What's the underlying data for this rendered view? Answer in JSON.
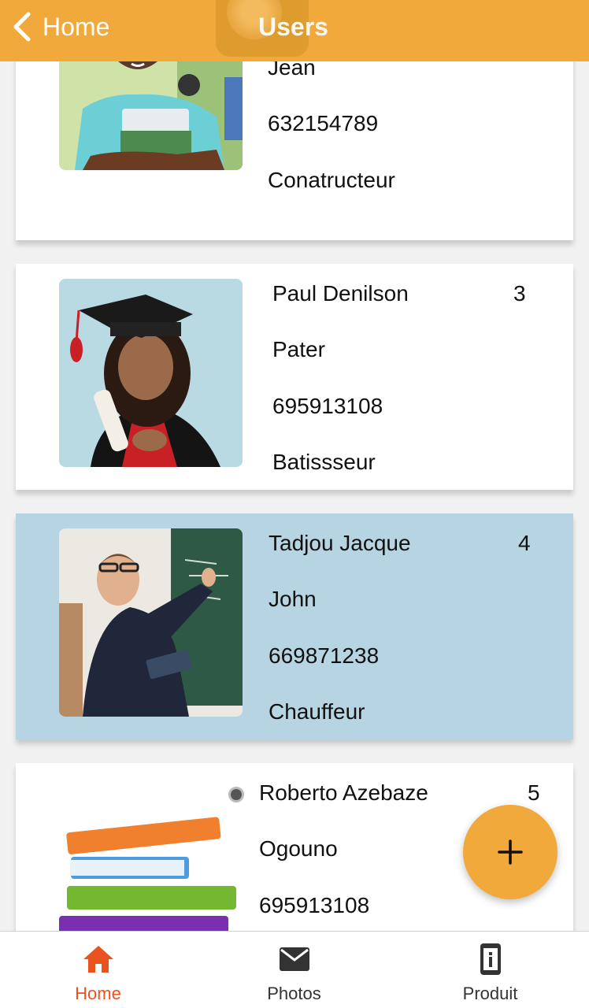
{
  "header": {
    "back_label": "Home",
    "title": "Users"
  },
  "users": [
    {
      "lines": [
        "Jean",
        "632154789",
        "Conatructeur"
      ],
      "index": ""
    },
    {
      "lines": [
        "Paul Denilson",
        "Pater",
        "695913108",
        "Batissseur"
      ],
      "index": "3"
    },
    {
      "lines": [
        "Tadjou Jacque",
        "John",
        "669871238",
        "Chauffeur"
      ],
      "index": "4"
    },
    {
      "lines": [
        "Roberto Azebaze",
        "Ogouno",
        "695913108"
      ],
      "index": "5"
    }
  ],
  "tabs": [
    {
      "label": "Home",
      "icon": "home-icon",
      "active": true
    },
    {
      "label": "Photos",
      "icon": "mail-icon",
      "active": false
    },
    {
      "label": "Produit",
      "icon": "device-info-icon",
      "active": false
    }
  ],
  "colors": {
    "accent": "#f2a93b",
    "selected_row": "#b6d4e2",
    "active_tab": "#e8531f"
  }
}
